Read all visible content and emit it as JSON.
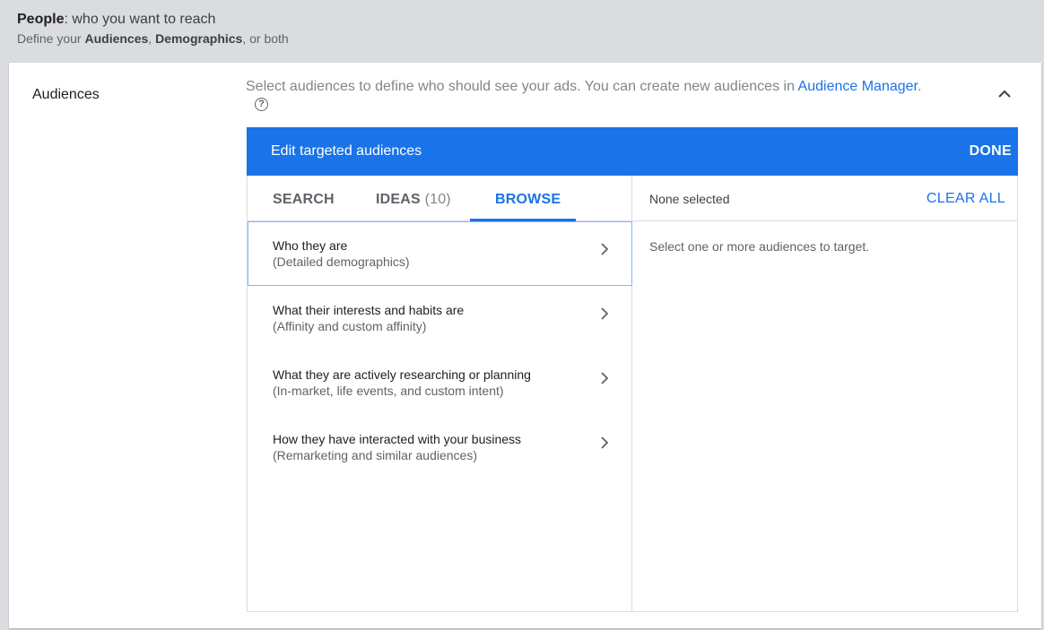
{
  "header": {
    "title_bold": "People",
    "title_rest": ": who you want to reach",
    "subtitle_pre": "Define your ",
    "subtitle_b1": "Audiences",
    "subtitle_mid": ", ",
    "subtitle_b2": "Demographics",
    "subtitle_post": ", or both"
  },
  "section": {
    "label": "Audiences",
    "description": "Select audiences to define who should see your ads.  You can create new audiences in ",
    "link": "Audience Manager",
    "link_suffix": ".",
    "help_glyph": "?"
  },
  "panel": {
    "title": "Edit targeted audiences",
    "done_label": "DONE",
    "tabs": {
      "search": "SEARCH",
      "ideas": "IDEAS",
      "ideas_count": "(10)",
      "browse": "BROWSE",
      "active": "browse"
    },
    "categories": [
      {
        "title": "Who they are",
        "subtitle": "(Detailed demographics)"
      },
      {
        "title": "What their interests and habits are",
        "subtitle": "(Affinity and custom affinity)"
      },
      {
        "title": "What they are actively researching or planning",
        "subtitle": "(In-market, life events, and custom intent)"
      },
      {
        "title": "How they have interacted with your business",
        "subtitle": "(Remarketing and similar audiences)"
      }
    ],
    "selection": {
      "status": "None selected",
      "clear_label": "CLEAR ALL",
      "empty_message": "Select one or more audiences to target."
    }
  },
  "colors": {
    "accent": "#1a73e8",
    "page_bg": "#dadce0",
    "selected_border": "#8ab4f8"
  },
  "icons": [
    "help-icon",
    "chevron-up-icon",
    "chevron-right-icon"
  ]
}
